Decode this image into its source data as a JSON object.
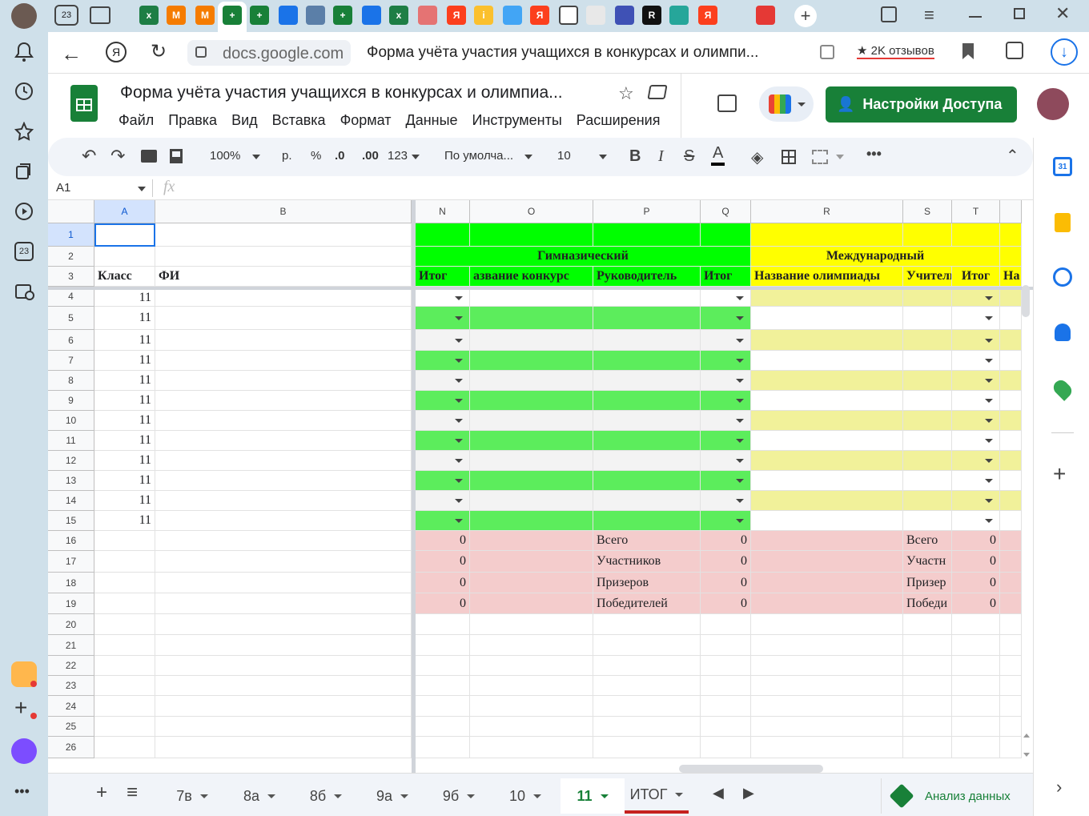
{
  "browser": {
    "url": "docs.google.com",
    "tab_title": "Форма учёта участия учащихся в конкурсах и олимпи...",
    "reviews": "2K отзывов",
    "tab_badge": "23"
  },
  "doc": {
    "title": "Форма учёта участия учащихся в конкурсах и олимпиа...",
    "menu": [
      "Файл",
      "Правка",
      "Вид",
      "Вставка",
      "Формат",
      "Данные",
      "Инструменты",
      "Расширения"
    ],
    "share_button": "Настройки Доступа"
  },
  "toolbar": {
    "zoom": "100%",
    "currency": "р.",
    "percent": "%",
    "dec_less": ".0",
    "dec_more": ".00",
    "number_format": "123",
    "font": "По умолча...",
    "font_size": "10"
  },
  "formula": {
    "cell_ref": "A1",
    "fx": "fx",
    "value": ""
  },
  "columns": [
    "A",
    "B",
    "N",
    "O",
    "P",
    "Q",
    "R",
    "S",
    "T"
  ],
  "rows": [
    "1",
    "2",
    "3",
    "4",
    "5",
    "6",
    "7",
    "8",
    "9",
    "10",
    "11",
    "12",
    "13",
    "14",
    "15",
    "16",
    "17",
    "18",
    "19",
    "20",
    "21",
    "22",
    "23",
    "24",
    "25",
    "26"
  ],
  "sheet": {
    "group_gym": "Гимназический",
    "group_intl": "Международный",
    "headers": {
      "A": "Класс",
      "B": "ФИ",
      "N": "Итог",
      "O": "азвание конкурс",
      "P": "Руководитель",
      "Q": "Итог",
      "R": "Название олимпиады",
      "S": "Учитель",
      "T": "Итог",
      "U": "На"
    },
    "class_value": "11",
    "summary": {
      "zero": "0",
      "labels_p": [
        "Всего",
        "Участников",
        "Призеров",
        "Победителей"
      ],
      "labels_s": [
        "Всего",
        "Участн",
        "Призер",
        "Победи"
      ]
    }
  },
  "sheet_tabs": [
    "7в",
    "8а",
    "8б",
    "9а",
    "9б",
    "10",
    "11",
    "ИТОГ"
  ],
  "active_tab": "11",
  "explore": "Анализ данных",
  "colors": {
    "green_header": "#00ff00",
    "green_row": "#5ced5c",
    "yellow_header": "#ffff00",
    "yellow_row": "#f1f19a",
    "pink_summary": "#f4cccc",
    "gray_row": "#f3f3f3",
    "sheets_green": "#188038",
    "share_green": "#188038"
  }
}
